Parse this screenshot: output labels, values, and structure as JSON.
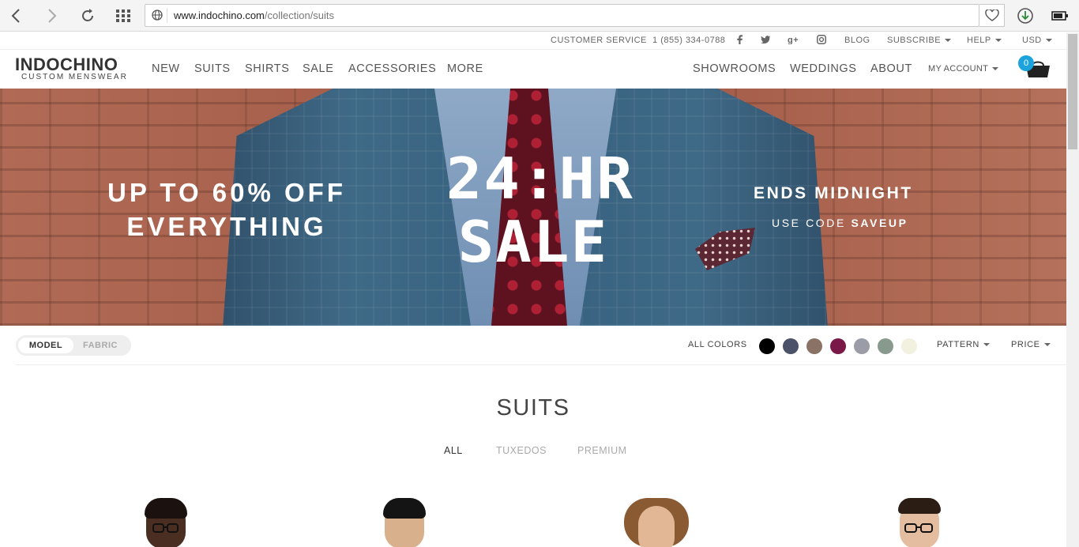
{
  "browser": {
    "url_domain": "www.indochino.com",
    "url_path": "/collection/suits"
  },
  "utility_bar": {
    "customer_service_label": "CUSTOMER SERVICE",
    "phone": "1 (855) 334-0788",
    "social_icons": [
      "facebook-icon",
      "twitter-icon",
      "google-plus-icon",
      "instagram-icon"
    ],
    "blog": "BLOG",
    "subscribe": "SUBSCRIBE",
    "help": "HELP",
    "currency": "USD"
  },
  "header": {
    "logo_name": "INDOCHINO",
    "logo_sub": "CUSTOM MENSWEAR",
    "nav_left": [
      "NEW",
      "SUITS",
      "SHIRTS",
      "SALE",
      "ACCESSORIES",
      "MORE"
    ],
    "nav_right": [
      "SHOWROOMS",
      "WEDDINGS",
      "ABOUT"
    ],
    "my_account": "MY ACCOUNT",
    "cart_count": "0"
  },
  "hero": {
    "left_line1": "UP TO 60% OFF",
    "left_line2": "EVERYTHING",
    "mid_line1": "24:HR",
    "mid_line2": "SALE",
    "right_line1": "ENDS MIDNIGHT",
    "right_line2_prefix": "USE CODE",
    "right_line2_code": "SAVEUP"
  },
  "filters": {
    "toggle_on": "MODEL",
    "toggle_off": "FABRIC",
    "all_colors": "ALL COLORS",
    "swatches": [
      "#000000",
      "#4a5168",
      "#8a7366",
      "#7a1848",
      "#9a9ca8",
      "#889a8e",
      "#f2f0df"
    ],
    "pattern": "PATTERN",
    "price": "PRICE"
  },
  "content": {
    "title": "SUITS",
    "tabs": [
      "ALL",
      "TUXEDOS",
      "PREMIUM"
    ],
    "active_tab": "ALL"
  },
  "colors": {
    "accent": "#1ba3dd",
    "text": "#555555"
  }
}
